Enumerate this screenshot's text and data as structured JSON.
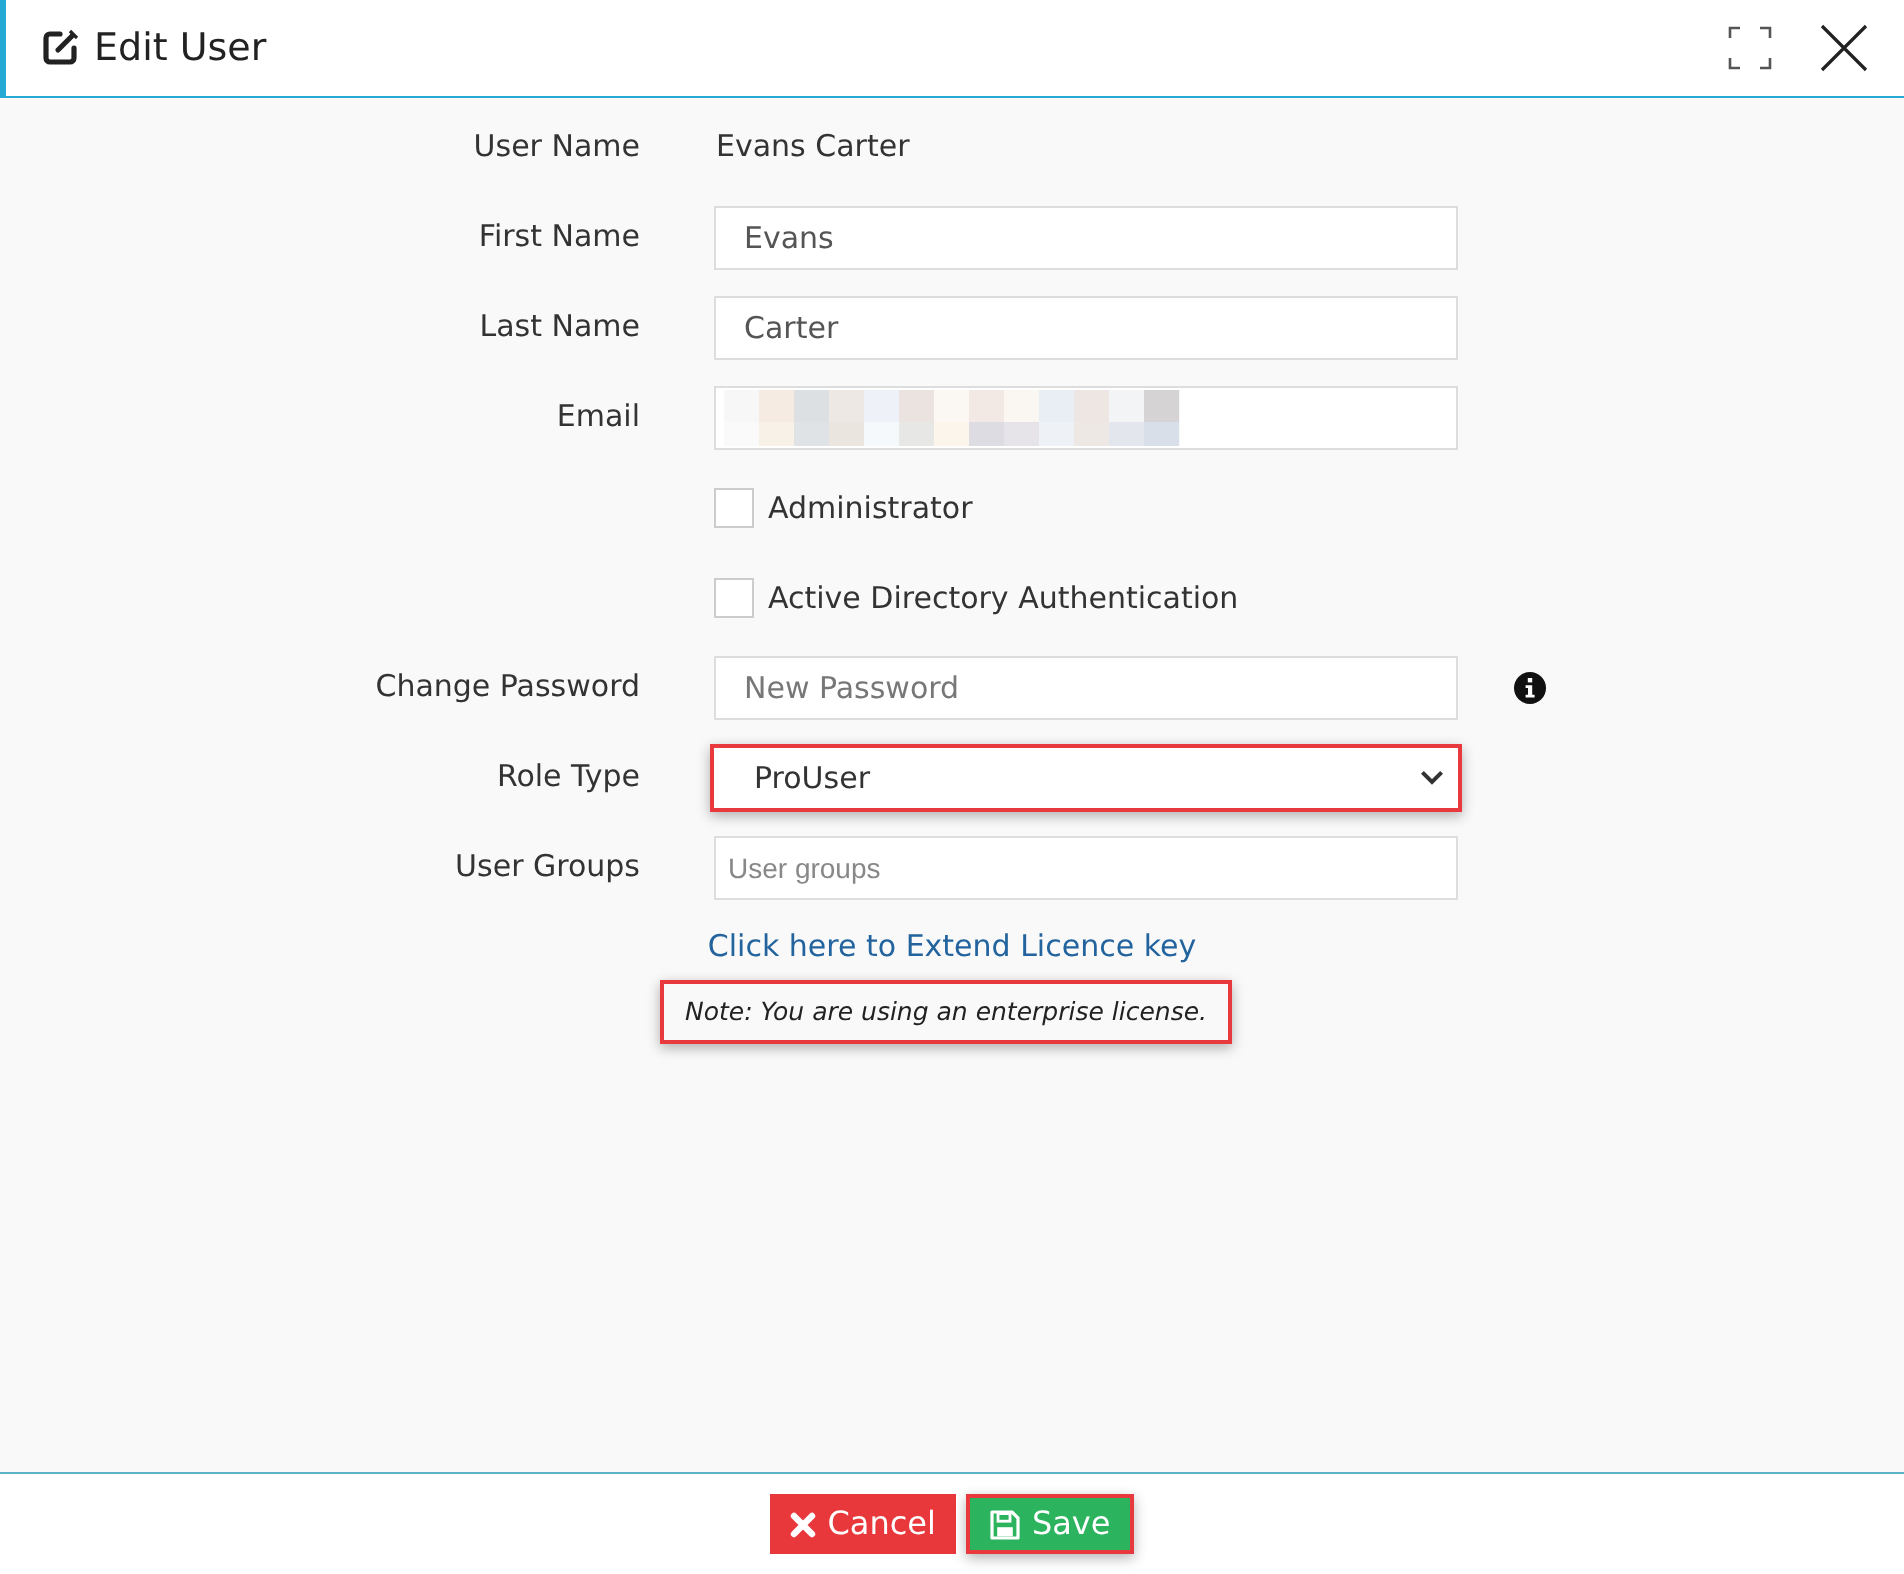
{
  "dialog": {
    "title": "Edit User"
  },
  "fields": [
    {
      "kind": "text",
      "label": "User Name",
      "value": "Evans Carter",
      "highlighted": false
    },
    {
      "kind": "input",
      "label": "First Name",
      "value": "Evans",
      "highlighted": false
    },
    {
      "kind": "input",
      "label": "Last Name",
      "value": "Carter",
      "highlighted": false
    },
    {
      "kind": "redacted",
      "label": "Email",
      "highlighted": false
    },
    {
      "kind": "checkbox",
      "label": "Administrator",
      "checked": false,
      "highlighted": false
    },
    {
      "kind": "checkbox",
      "label": "Active Directory Authentication",
      "checked": false,
      "highlighted": false
    },
    {
      "kind": "password",
      "label": "Change Password",
      "placeholder": "New Password",
      "info": true,
      "highlighted": false
    },
    {
      "kind": "select",
      "label": "Role Type",
      "value": "ProUser",
      "highlighted": true
    },
    {
      "kind": "groups",
      "label": "User Groups",
      "placeholder": "User groups",
      "highlighted": false
    }
  ],
  "licence_link": "Click here to Extend Licence key",
  "note": {
    "text": "Note: You are using an enterprise license.",
    "highlighted": true
  },
  "buttons": [
    {
      "kind": "cancel",
      "label": "Cancel",
      "highlighted": false
    },
    {
      "kind": "save",
      "label": "Save",
      "highlighted": true
    }
  ]
}
